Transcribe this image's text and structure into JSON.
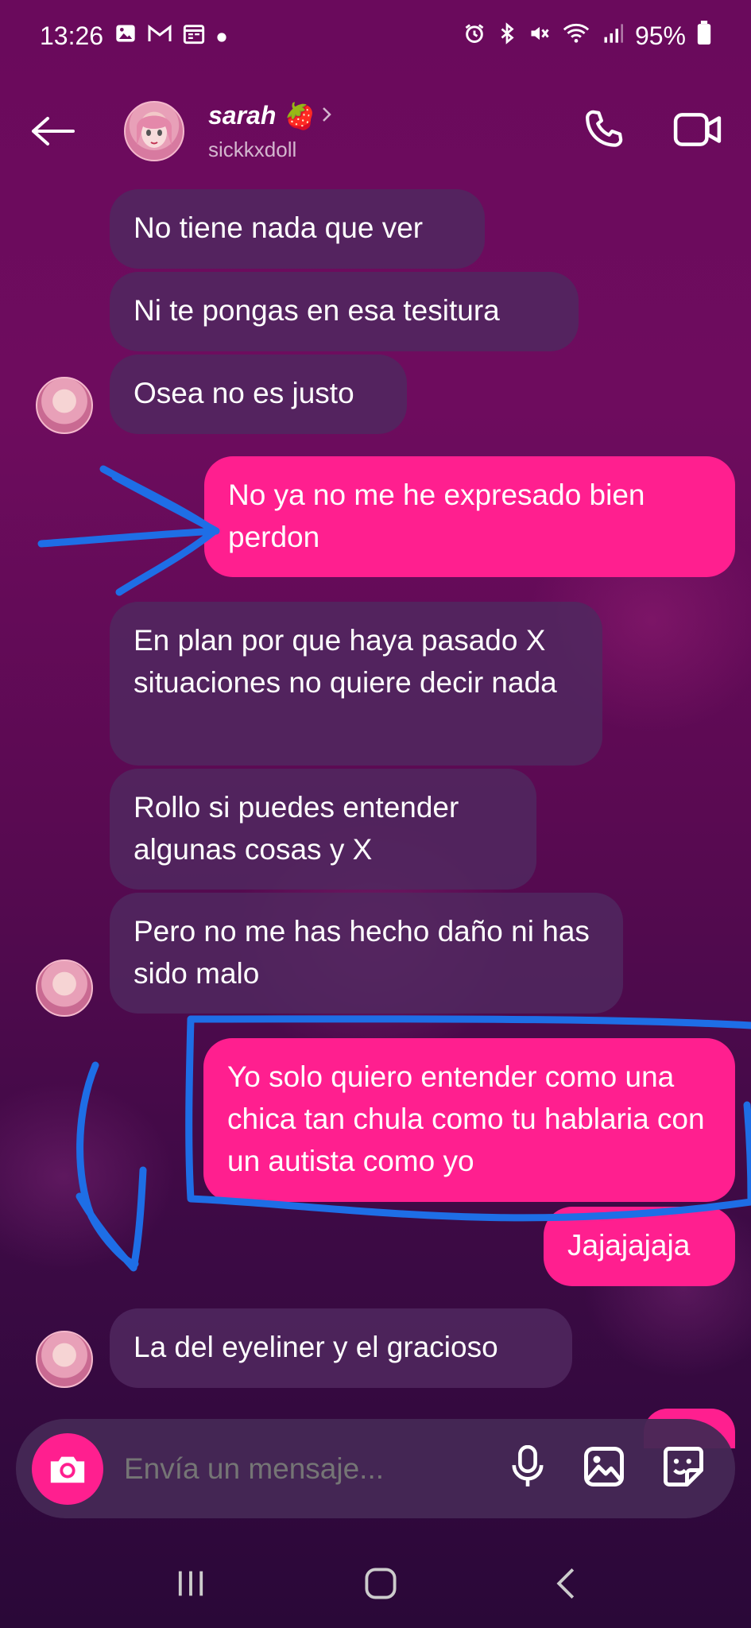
{
  "status_bar": {
    "time": "13:26",
    "battery": "95%",
    "left_icons": [
      "image-icon",
      "gmail-icon",
      "calendar-icon",
      "dot-icon"
    ],
    "right_icons": [
      "alarm-icon",
      "bluetooth-icon",
      "mute-icon",
      "wifi-icon",
      "signal-icon",
      "battery-icon"
    ]
  },
  "header": {
    "name": "sarah",
    "name_emoji": "🍓",
    "handle": "sickkxdoll",
    "icons": [
      "back-arrow-icon",
      "chevron-right-icon",
      "phone-icon",
      "video-icon"
    ]
  },
  "messages": [
    {
      "dir": "recv",
      "text": "No tiene nada que ver"
    },
    {
      "dir": "recv",
      "text": "Ni te pongas en esa tesitura"
    },
    {
      "dir": "recv",
      "text": "Osea no es justo"
    },
    {
      "dir": "sent",
      "text": "No ya no me he expresado bien perdon"
    },
    {
      "dir": "recv",
      "text": "En plan por que haya pasado X situaciones no quiere decir nada"
    },
    {
      "dir": "recv",
      "text": "Rollo si puedes entender algunas cosas y X"
    },
    {
      "dir": "recv",
      "text": "Pero no me has hecho daño ni has sido malo"
    },
    {
      "dir": "sent",
      "text": "Yo solo quiero entender como una chica tan chula como tu hablaria con un autista como yo"
    },
    {
      "dir": "sent",
      "text": "Jajajajaja"
    },
    {
      "dir": "recv",
      "text": "La del eyeliner y el gracioso"
    }
  ],
  "composer": {
    "placeholder": "Envía un mensaje...",
    "icons": [
      "camera-icon",
      "microphone-icon",
      "gallery-icon",
      "sticker-icon"
    ]
  },
  "navbar": {
    "icons": [
      "recent-apps-icon",
      "home-icon",
      "back-icon"
    ]
  },
  "colors": {
    "sent_bubble": "#ff1f8f",
    "received_bubble": "#50285f",
    "annotation_marker": "#1e6ee6",
    "background_top": "#6a0a5c",
    "background_bottom": "#2a0838"
  }
}
